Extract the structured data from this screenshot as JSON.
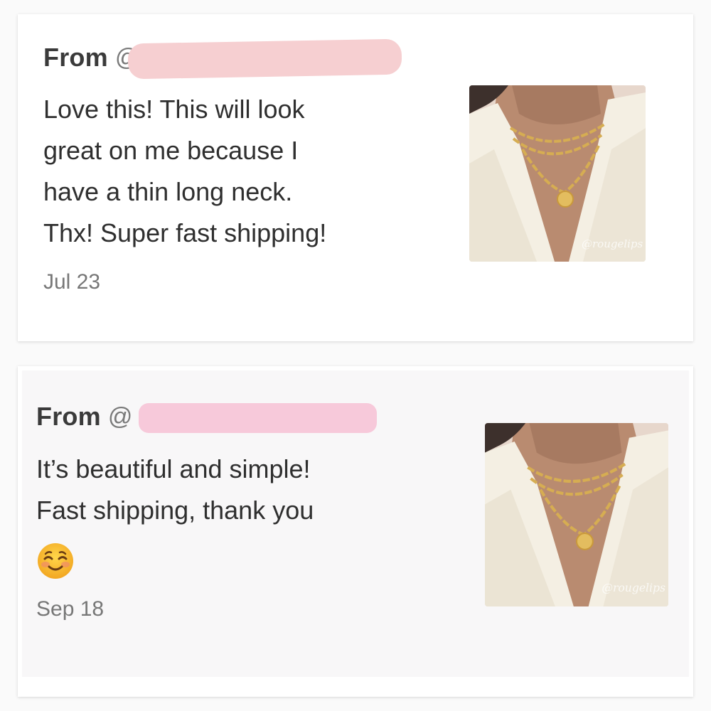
{
  "reviews": [
    {
      "from_label": "From",
      "handle_prefix": "@",
      "text": "Love this! This will look\ngreat on me because I\nhave a thin long neck.\nThx! Super fast shipping!",
      "date": "Jul 23",
      "photo_watermark": "@rougelips"
    },
    {
      "from_label": "From",
      "handle_prefix": "@",
      "text": "It’s beautiful and simple!\nFast shipping, thank you",
      "emoji": "smiling-face-icon",
      "date": "Sep 18",
      "photo_watermark": "@rougelips"
    }
  ],
  "colors": {
    "redaction": "#f6cfd1",
    "redaction_2": "#f7c9da",
    "text": "#2f2f2f",
    "date": "#777777",
    "gold": "#d6ad52"
  }
}
